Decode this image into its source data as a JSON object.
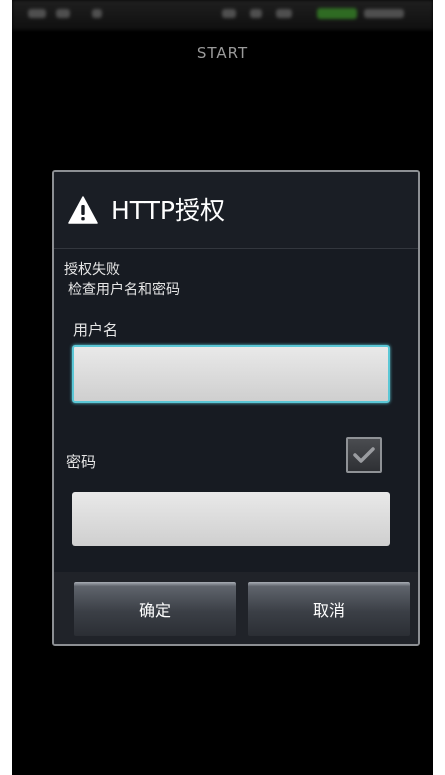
{
  "app": {
    "title": "START"
  },
  "dialog": {
    "title": "HTTP授权",
    "icon": "warning-icon",
    "message_line1": "授权失败",
    "message_line2": "检查用户名和密码",
    "username": {
      "label": "用户名",
      "value": ""
    },
    "password": {
      "label": "密码",
      "value": "",
      "show_password_checked": true
    },
    "buttons": {
      "ok_label": "确定",
      "cancel_label": "取消"
    }
  },
  "colors": {
    "focus_accent": "#5bc7d6",
    "dialog_bg": "#171b22",
    "screen_bg": "#000000"
  }
}
